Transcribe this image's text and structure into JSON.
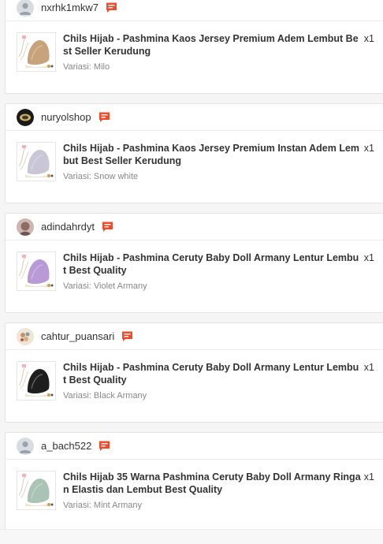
{
  "orders": [
    {
      "shop_name": "nxrhk1mkw7",
      "avatar": "default-user-icon",
      "product_title": "Chils Hijab - Pashmina Kaos Jersey Premium Adem Lembut Best Seller Kerudung",
      "quantity": "x1",
      "variation": "Variasi: Milo",
      "product_color": "#c8a27a"
    },
    {
      "shop_name": "nuryolshop",
      "avatar": "shop-logo",
      "product_title": "Chils Hijab - Pashmina Kaos Jersey Premium Instan Adem Lembut Best Seller Kerudung",
      "quantity": "x1",
      "variation": "Variasi: Snow white",
      "product_color": "#c9c6d6"
    },
    {
      "shop_name": "adindahrdyt",
      "avatar": "user-photo",
      "product_title": "Chils Hijab - Pashmina Ceruty Baby Doll Armany Lentur Lembut Best Quality",
      "quantity": "x1",
      "variation": "Variasi: Violet Armany",
      "product_color": "#b79ad6"
    },
    {
      "shop_name": "cahtur_puansari",
      "avatar": "user-photo",
      "product_title": "Chils Hijab - Pashmina Ceruty Baby Doll Armany Lentur Lembut Best Quality",
      "quantity": "x1",
      "variation": "Variasi: Black Armany",
      "product_color": "#1e1e1e"
    },
    {
      "shop_name": "a_bach522",
      "avatar": "default-user-icon",
      "product_title": "Chils Hijab 35 Warna Pashmina Ceruty Baby Doll Armany Ringan Elastis dan Lembut Best Quality",
      "quantity": "x1",
      "variation": "Variasi: Mint Armany",
      "product_color": "#a9c3b4"
    }
  ],
  "colors": {
    "chat_icon": "#ee4d2d",
    "text": "#333333",
    "muted": "#888888"
  }
}
